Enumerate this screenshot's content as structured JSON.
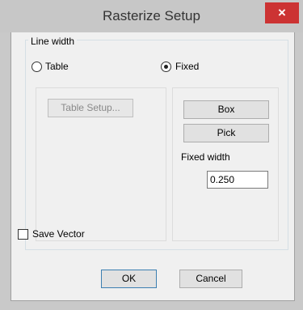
{
  "window": {
    "title": "Rasterize Setup",
    "close_symbol": "×"
  },
  "line_width_group": {
    "legend": "Line width",
    "radio_table_label": "Table",
    "radio_fixed_label": "Fixed",
    "selected": "Fixed",
    "table_setup_label": "Table Setup...",
    "box_label": "Box",
    "pick_label": "Pick",
    "fixed_width_label": "Fixed width",
    "fixed_width_value": "0.250"
  },
  "save_vector_label": "Save Vector",
  "save_vector_checked": false,
  "buttons": {
    "ok_label": "OK",
    "cancel_label": "Cancel"
  },
  "colors": {
    "close_button": "#cc3333",
    "titlebar": "#c7c7c7",
    "dialog_background": "#f0f0f0"
  }
}
